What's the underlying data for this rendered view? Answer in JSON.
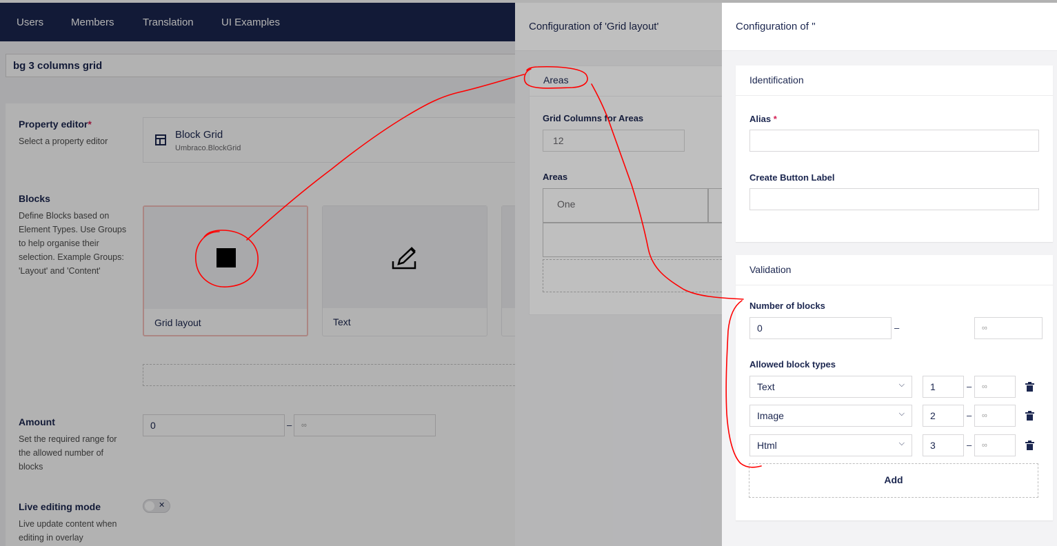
{
  "topnav": {
    "items": [
      "Users",
      "Members",
      "Translation",
      "UI Examples"
    ]
  },
  "datatype_name": "bg 3 columns grid",
  "property_editor": {
    "label": "Property editor",
    "required_mark": "*",
    "description": "Select a property editor",
    "name": "Block Grid",
    "alias": "Umbraco.BlockGrid"
  },
  "blocks": {
    "label": "Blocks",
    "description": [
      "Define Blocks based on",
      "Element Types. Use Groups",
      "to help organise their",
      "selection. Example Groups:",
      "'Layout' and 'Content'"
    ],
    "cards": [
      {
        "label": "Grid layout",
        "icon": "square-icon"
      },
      {
        "label": "Text",
        "icon": "edit-icon"
      }
    ]
  },
  "amount": {
    "label": "Amount",
    "description": [
      "Set the required range for",
      "the allowed number of",
      "blocks"
    ],
    "min": "0",
    "dash": "–",
    "max_placeholder": "∞"
  },
  "live_editing": {
    "label": "Live editing mode",
    "description": [
      "Live update content when",
      "editing in overlay"
    ],
    "toggle_symbol": "✕"
  },
  "middle_editor": {
    "title": "Configuration of 'Grid layout'",
    "section_title": "Areas",
    "grid_columns_label": "Grid Columns for Areas",
    "grid_columns_value": "12",
    "areas_label": "Areas",
    "area_names": [
      "One"
    ]
  },
  "right_editor": {
    "title": "Configuration of ''",
    "identification": {
      "title": "Identification",
      "alias_label": "Alias",
      "alias_required": "*",
      "alias_value": "",
      "create_button_label": "Create Button Label",
      "create_button_value": ""
    },
    "validation": {
      "title": "Validation",
      "number_of_blocks_label": "Number of blocks",
      "min": "0",
      "dash": "–",
      "max_placeholder": "∞",
      "allowed_block_types_label": "Allowed block types",
      "rows": [
        {
          "type": "Text",
          "min": "1",
          "max_placeholder": "∞"
        },
        {
          "type": "Image",
          "min": "2",
          "max_placeholder": "∞"
        },
        {
          "type": "Html",
          "min": "3",
          "max_placeholder": "∞"
        }
      ],
      "add_label": "Add"
    }
  },
  "colors": {
    "nav": "#1b264f",
    "required": "#d42054",
    "annotation": "#ff0000"
  }
}
